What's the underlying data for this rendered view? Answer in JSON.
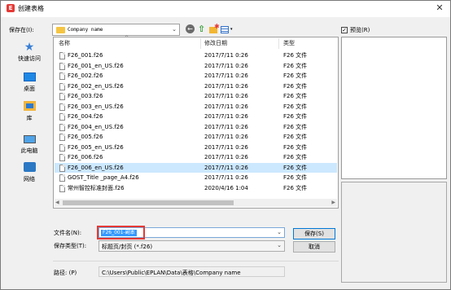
{
  "window": {
    "title": "创建表格",
    "close_glyph": "✕"
  },
  "toolbar": {
    "save_in_label": "保存在(I):",
    "current_folder": "Company name",
    "back_glyph": "←",
    "up_glyph": "⇧",
    "view_menu_glyph": "▾"
  },
  "places": [
    {
      "label": "快速访问",
      "icon": "star-icon"
    },
    {
      "label": "桌面",
      "icon": "desktop-icon"
    },
    {
      "label": "库",
      "icon": "library-icon"
    },
    {
      "label": "此电脑",
      "icon": "computer-icon"
    },
    {
      "label": "网络",
      "icon": "network-icon"
    }
  ],
  "list": {
    "columns": {
      "name": "名称",
      "date": "修改日期",
      "type": "类型"
    },
    "rows": [
      {
        "name": "F26_001.f26",
        "date": "2017/7/11 0:26",
        "type": "F26 文件"
      },
      {
        "name": "F26_001_en_US.f26",
        "date": "2017/7/11 0:26",
        "type": "F26 文件"
      },
      {
        "name": "F26_002.f26",
        "date": "2017/7/11 0:26",
        "type": "F26 文件"
      },
      {
        "name": "F26_002_en_US.f26",
        "date": "2017/7/11 0:26",
        "type": "F26 文件"
      },
      {
        "name": "F26_003.f26",
        "date": "2017/7/11 0:26",
        "type": "F26 文件"
      },
      {
        "name": "F26_003_en_US.f26",
        "date": "2017/7/11 0:26",
        "type": "F26 文件"
      },
      {
        "name": "F26_004.f26",
        "date": "2017/7/11 0:26",
        "type": "F26 文件"
      },
      {
        "name": "F26_004_en_US.f26",
        "date": "2017/7/11 0:26",
        "type": "F26 文件"
      },
      {
        "name": "F26_005.f26",
        "date": "2017/7/11 0:26",
        "type": "F26 文件"
      },
      {
        "name": "F26_005_en_US.f26",
        "date": "2017/7/11 0:26",
        "type": "F26 文件"
      },
      {
        "name": "F26_006.f26",
        "date": "2017/7/11 0:26",
        "type": "F26 文件"
      },
      {
        "name": "F26_006_en_US.f26",
        "date": "2017/7/11 0:26",
        "type": "F26 文件"
      },
      {
        "name": "GOST_Title _page_A4.f26",
        "date": "2017/7/11 0:26",
        "type": "F26 文件"
      },
      {
        "name": "常州智控标准封面.f26",
        "date": "2020/4/16 1:04",
        "type": "F26 文件"
      }
    ],
    "selected_index": 11
  },
  "preview": {
    "label": "预览(R)",
    "checked": true,
    "check_glyph": "✓"
  },
  "form": {
    "filename_label": "文件名(N):",
    "filename_value": "F26_001-副本",
    "filetype_label": "保存类型(T):",
    "filetype_value": "标题页/封页 (*.f26)",
    "save_button": "保存(S)",
    "cancel_button": "取消",
    "path_label": "路径:  (P)",
    "path_value": "C:\\Users\\Public\\EPLAN\\Data\\表格\\Company name"
  }
}
